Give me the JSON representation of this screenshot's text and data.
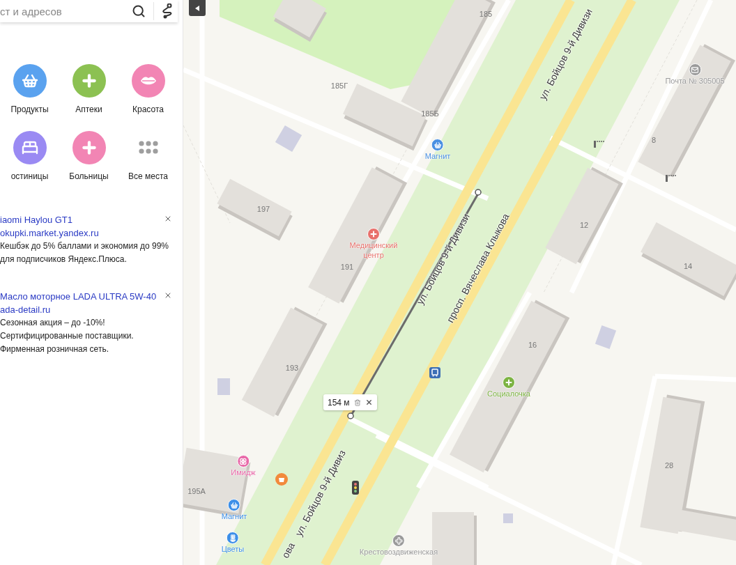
{
  "search": {
    "placeholder": "ст и адресов"
  },
  "categories": [
    {
      "label": "Продукты",
      "kind": "basket",
      "color": "#5aa2ef"
    },
    {
      "label": "Аптеки",
      "kind": "plus",
      "color": "#8cc152"
    },
    {
      "label": "Красота",
      "kind": "lips",
      "color": "#f285b4"
    },
    {
      "label": "остиницы",
      "kind": "bed",
      "color": "#9a8af3"
    },
    {
      "label": "Больницы",
      "kind": "plus",
      "color": "#f285b4"
    },
    {
      "label": "Все места",
      "kind": "all",
      "color": "#9e9e9e"
    }
  ],
  "ads": [
    {
      "title": "iaomi Haylou GT1",
      "domain": "okupki.market.yandex.ru",
      "text": "Кешбэк до 5% баллами и экономия до 99% для подписчиков Яндекс.Плюса."
    },
    {
      "title": "Масло моторное LADA ULTRA 5W-40",
      "domain": "ada-detail.ru",
      "text": "Сезонная акция – до -10%! Сертифицированные поставщики. Фирменная розничная сеть."
    }
  ],
  "map": {
    "streets": [
      "ул. Бойцов 9-й Дивизи",
      "ул. Бойцов 9-й Дивизи",
      "ул. Бойцов 9-й Дивиз",
      "просп. Вячеслава Клыкова",
      "ова"
    ],
    "houses": [
      "185",
      "185Г",
      "185Б",
      "197",
      "191",
      "193",
      "195А",
      "12",
      "14",
      "8",
      "16",
      "28"
    ],
    "places": [
      {
        "name": "Почта № 305005",
        "kind": "mail",
        "color": "#9a9a9a"
      },
      {
        "name": "Магнит",
        "kind": "basket",
        "color": "#4a90e2"
      },
      {
        "name": "Медицинский центр",
        "kind": "plus",
        "color": "#e8706b"
      },
      {
        "name": "Социалочка",
        "kind": "plus",
        "color": "#7cb342"
      },
      {
        "name": "Имидж",
        "kind": "lotus",
        "color": "#e868a8"
      },
      {
        "name": "Магнит",
        "kind": "basket",
        "color": "#3d8fe8"
      },
      {
        "name": "Цветы",
        "kind": "flower",
        "color": "#3d8fe8"
      },
      {
        "name": "Крестовоздвиженская",
        "kind": "cross",
        "color": "#9a9a9a"
      }
    ],
    "ruler": {
      "distance": "154 м"
    }
  }
}
